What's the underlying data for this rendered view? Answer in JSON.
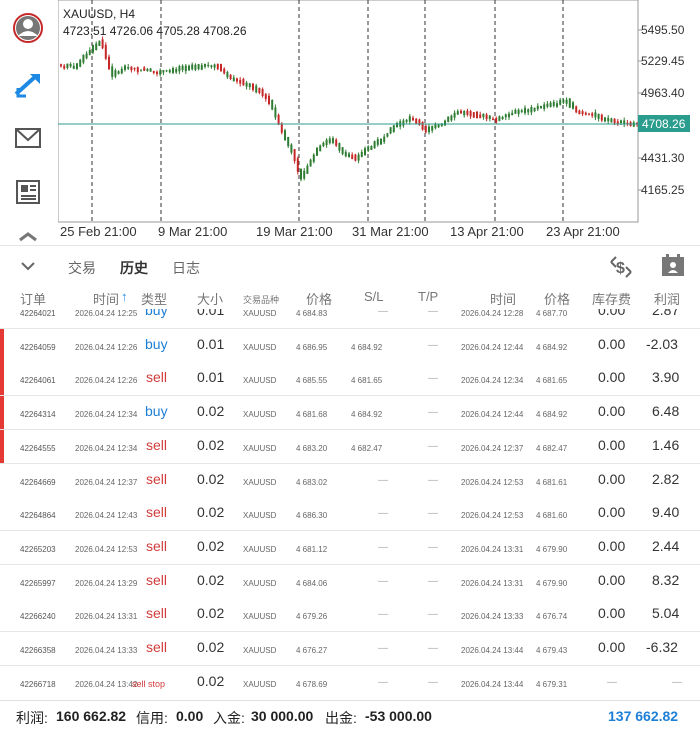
{
  "chart": {
    "symbol_tf": "XAUUSD, H4",
    "ohlc": "4723.51 4726.06 4705.28 4708.26",
    "current_price": "4708.26",
    "price_axis": [
      "5495.50",
      "5229.45",
      "4963.40",
      "4431.30",
      "4165.25"
    ],
    "time_axis": [
      "25 Feb 21:00",
      "9 Mar 21:00",
      "19 Mar 21:00",
      "31 Mar 21:00",
      "13 Apr 21:00",
      "23 Apr 21:00"
    ],
    "colors": {
      "bull": "#2e7d32",
      "bear": "#c62828",
      "current_line": "#2a9d8f"
    }
  },
  "sidebar": {
    "icons": [
      "account-icon",
      "trade-icon",
      "mail-icon",
      "news-icon",
      "more-icon"
    ]
  },
  "tabs": {
    "items": [
      {
        "label": "交易"
      },
      {
        "label": "历史"
      },
      {
        "label": "日志"
      }
    ],
    "active": "历史"
  },
  "header": {
    "order": "订单",
    "time": "时间",
    "sort_arrow": "↑",
    "type": "类型",
    "volume": "大小",
    "symbol": "交易品种",
    "price": "价格",
    "sl": "S/L",
    "tp": "T/P",
    "close_time": "时间",
    "close_price": "价格",
    "swap": "库存费",
    "profit": "利润"
  },
  "rows": [
    {
      "order": "42264021",
      "time": "2026.04.24 12:25",
      "type": "buy",
      "volume": "0.01",
      "symbol": "XAUUSD",
      "price": "4 684.83",
      "sl": "—",
      "tp": "—",
      "close_time": "2026.04.24 12:28",
      "close_price": "4 687.70",
      "swap": "0.00",
      "profit": "2.87",
      "mark": false
    },
    {
      "order": "42264059",
      "time": "2026.04.24 12:26",
      "type": "buy",
      "volume": "0.01",
      "symbol": "XAUUSD",
      "price": "4 686.95",
      "sl": "4 684.92",
      "tp": "—",
      "close_time": "2026.04.24 12:44",
      "close_price": "4 684.92",
      "swap": "0.00",
      "profit": "-2.03",
      "mark": true
    },
    {
      "order": "42264061",
      "time": "2026.04.24 12:26",
      "type": "sell",
      "volume": "0.01",
      "symbol": "XAUUSD",
      "price": "4 685.55",
      "sl": "4 681.65",
      "tp": "—",
      "close_time": "2026.04.24 12:34",
      "close_price": "4 681.65",
      "swap": "0.00",
      "profit": "3.90",
      "mark": true
    },
    {
      "order": "42264314",
      "time": "2026.04.24 12:34",
      "type": "buy",
      "volume": "0.02",
      "symbol": "XAUUSD",
      "price": "4 681.68",
      "sl": "4 684.92",
      "tp": "—",
      "close_time": "2026.04.24 12:44",
      "close_price": "4 684.92",
      "swap": "0.00",
      "profit": "6.48",
      "mark": true
    },
    {
      "order": "42264555",
      "time": "2026.04.24 12:34",
      "type": "sell",
      "volume": "0.02",
      "symbol": "XAUUSD",
      "price": "4 683.20",
      "sl": "4 682.47",
      "tp": "—",
      "close_time": "2026.04.24 12:37",
      "close_price": "4 682.47",
      "swap": "0.00",
      "profit": "1.46",
      "mark": true
    },
    {
      "order": "42264669",
      "time": "2026.04.24 12:37",
      "type": "sell",
      "volume": "0.02",
      "symbol": "XAUUSD",
      "price": "4 683.02",
      "sl": "—",
      "tp": "—",
      "close_time": "2026.04.24 12:53",
      "close_price": "4 681.61",
      "swap": "0.00",
      "profit": "2.82",
      "mark": false
    },
    {
      "order": "42264864",
      "time": "2026.04.24 12:43",
      "type": "sell",
      "volume": "0.02",
      "symbol": "XAUUSD",
      "price": "4 686.30",
      "sl": "—",
      "tp": "—",
      "close_time": "2026.04.24 12:53",
      "close_price": "4 681.60",
      "swap": "0.00",
      "profit": "9.40",
      "mark": false
    },
    {
      "order": "42265203",
      "time": "2026.04.24 12:53",
      "type": "sell",
      "volume": "0.02",
      "symbol": "XAUUSD",
      "price": "4 681.12",
      "sl": "—",
      "tp": "—",
      "close_time": "2026.04.24 13:31",
      "close_price": "4 679.90",
      "swap": "0.00",
      "profit": "2.44",
      "mark": false
    },
    {
      "order": "42265997",
      "time": "2026.04.24 13:29",
      "type": "sell",
      "volume": "0.02",
      "symbol": "XAUUSD",
      "price": "4 684.06",
      "sl": "—",
      "tp": "—",
      "close_time": "2026.04.24 13:31",
      "close_price": "4 679.90",
      "swap": "0.00",
      "profit": "8.32",
      "mark": false
    },
    {
      "order": "42266240",
      "time": "2026.04.24 13:31",
      "type": "sell",
      "volume": "0.02",
      "symbol": "XAUUSD",
      "price": "4 679.26",
      "sl": "—",
      "tp": "—",
      "close_time": "2026.04.24 13:33",
      "close_price": "4 676.74",
      "swap": "0.00",
      "profit": "5.04",
      "mark": false
    },
    {
      "order": "42266358",
      "time": "2026.04.24 13:33",
      "type": "sell",
      "volume": "0.02",
      "symbol": "XAUUSD",
      "price": "4 676.27",
      "sl": "—",
      "tp": "—",
      "close_time": "2026.04.24 13:44",
      "close_price": "4 679.43",
      "swap": "0.00",
      "profit": "-6.32",
      "mark": false
    },
    {
      "order": "42266718",
      "time": "2026.04.24 13:42",
      "type": "sell stop",
      "volume": "0.02",
      "symbol": "XAUUSD",
      "price": "4 678.69",
      "sl": "—",
      "tp": "—",
      "close_time": "2026.04.24 13:44",
      "close_price": "4 679.31",
      "swap": "—",
      "profit": "—",
      "mark": false
    }
  ],
  "footer": {
    "profit_label": "利润:",
    "profit": "160 662.82",
    "credit_label": "信用:",
    "credit": "0.00",
    "deposit_label": "入金:",
    "deposit": "30 000.00",
    "withdraw_label": "出金:",
    "withdraw": "-53 000.00",
    "balance": "137 662.82"
  }
}
